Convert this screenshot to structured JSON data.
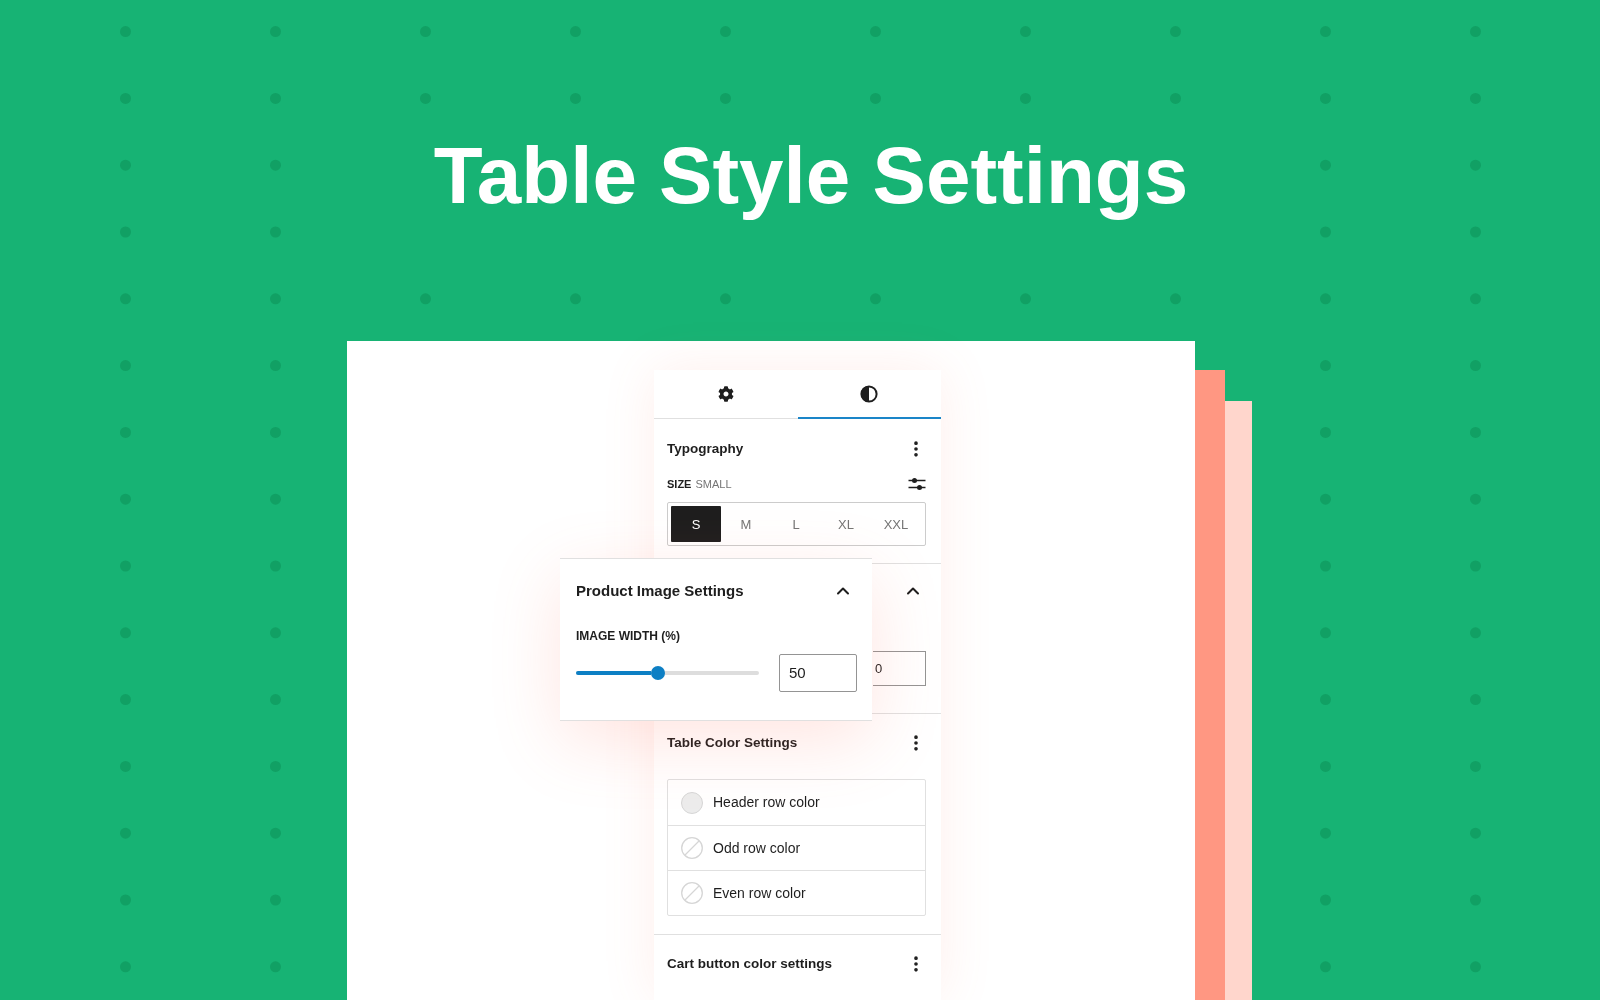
{
  "title": "Table Style Settings",
  "tabs": [
    {
      "kind": "settings",
      "selected": false
    },
    {
      "kind": "styles",
      "selected": true
    }
  ],
  "typography": {
    "title": "Typography",
    "size_label": "SIZE",
    "size_value": "SMALL",
    "sizes": [
      {
        "label": "S",
        "selected": true
      },
      {
        "label": "M",
        "selected": false
      },
      {
        "label": "L",
        "selected": false
      },
      {
        "label": "XL",
        "selected": false
      },
      {
        "label": "XXL",
        "selected": false
      }
    ]
  },
  "section_behind": {
    "expanded": true,
    "value": "0"
  },
  "image_settings": {
    "title": "Product Image Settings",
    "expanded": true,
    "field_label": "IMAGE WIDTH (%)",
    "level": 0.45,
    "value": "50"
  },
  "table_colors": {
    "title": "Table Color Settings",
    "rows": [
      {
        "label": "Header row color",
        "color": "#ececec"
      },
      {
        "label": "Odd row color"
      },
      {
        "label": "Even row color"
      }
    ]
  },
  "cart_colors": {
    "title": "Cart button color settings"
  }
}
